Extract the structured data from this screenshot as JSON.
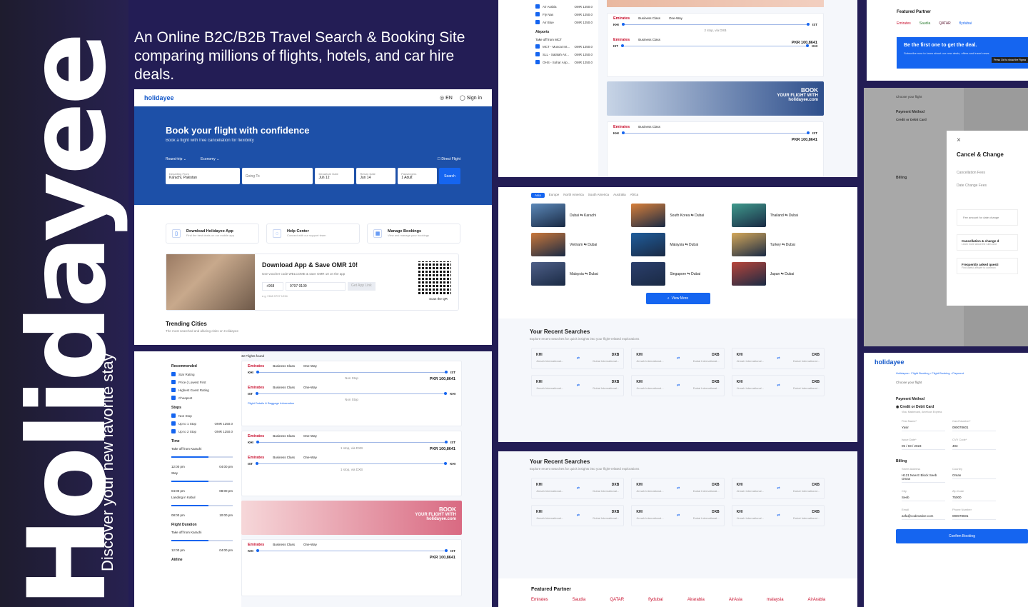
{
  "brand": "Holidayee",
  "tagline": "Discover your new favorite stay",
  "headline": "An Online B2C/B2B Travel Search & Booking Site comparing millions of flights, hotels, and car hire deals.",
  "home": {
    "logo": "holidayee",
    "lang": "EN",
    "signin": "Sign in",
    "hero_title": "Book your flight with confidence",
    "hero_sub": "Book a flight with free cancellation for flexibility",
    "trip_type": "Round-trip",
    "cabin": "Economy",
    "direct": "Direct Flight",
    "from_label": "Departing From",
    "from_value": "Karachi, Pakistan",
    "to_placeholder": "Going To",
    "dep_label": "Departure Date",
    "dep_value": "Jun 12",
    "ret_label": "Return Date",
    "ret_value": "Jun 14",
    "pax_label": "Passengers",
    "pax_value": "1 Adult",
    "search": "Search",
    "cards": [
      {
        "title": "Download Holidayee App",
        "sub": "Find the best deals on our mobile app",
        "icon": "phone-icon"
      },
      {
        "title": "Help Center",
        "sub": "Connect with our support team",
        "icon": "headset-icon"
      },
      {
        "title": "Manage Bookings",
        "sub": "View and manage your bookings",
        "icon": "calendar-icon"
      }
    ],
    "promo_title": "Download App & Save OMR 10!",
    "promo_sub": "Use voucher code WELCOME & save OMR 10 on the app",
    "country_code": "+968",
    "phone": "9797 9109",
    "get_link": "Get App Link",
    "hint": "e.g +968 9797 1234",
    "scan": "Scan the QR",
    "trending_title": "Trending Cities",
    "trending_sub": "The most searched and alluring cities on Holidayee"
  },
  "results": {
    "count": "32 Flights found",
    "filters": {
      "recommended": "Recommended",
      "rec_items": [
        "Star Rating",
        "Price ( Lowest First",
        "Highest Guest Rating",
        "Cheapest"
      ],
      "stops": "Stops",
      "stop_items": [
        {
          "label": "Non Stop",
          "price": ""
        },
        {
          "label": "Up to 1 Stop",
          "price": "OMR 1250.0"
        },
        {
          "label": "Up to 2 Stop",
          "price": "OMR 1250.0"
        }
      ],
      "time": "Time",
      "takeoff": "Take off from Karachi",
      "t1": "12:00 pm",
      "t2": "04:00 pm",
      "stay": "Stay",
      "t3": "04:00 pm",
      "t4": "08:00 pm",
      "landing": "Landing in Kabul",
      "t5": "08:00 pm",
      "t6": "10:00 pm",
      "duration": "Flight Duration",
      "takeoff2": "Take off from Karachi",
      "t7": "12:00 pm",
      "t8": "04:00 pm",
      "airline": "Airline"
    },
    "flights": [
      {
        "airline": "Emirates",
        "class": "Business Class",
        "way": "One-Way",
        "from": "KHI",
        "to": "IST",
        "dtime": "08:00 AM",
        "atime": "10:00 PM",
        "dur": "0h 55m",
        "stops": "Non Stop",
        "price": "PKR 100,8641"
      },
      {
        "airline": "Emirates",
        "class": "Business Class",
        "way": "One-Way",
        "from": "IST",
        "to": "KHI",
        "dtime": "12:00 AM",
        "atime": "02:00 AM",
        "dur": "0h 55m",
        "stops": "Non Stop",
        "price": ""
      },
      {
        "airline": "Emirates",
        "class": "Business Class",
        "way": "One-Way",
        "from": "KHI",
        "to": "IST",
        "dtime": "08:00 AM",
        "atime": "10:00 PM",
        "dur": "0h 55m",
        "stops": "1 stop, via DXB",
        "price": "PKR 100,8641"
      },
      {
        "airline": "Emirates",
        "class": "Business Class",
        "way": "One-Way",
        "from": "IST",
        "to": "KHI",
        "dtime": "12:00 AM",
        "atime": "02:00 AM",
        "dur": "0h 55m",
        "stops": "1 stop, via DXB",
        "price": ""
      }
    ],
    "details": "Flight Details & Baggage Information",
    "banner": "BOOK",
    "banner2": "YOUR FLIGHT WITH",
    "banner3": "holidayee.com"
  },
  "right_top": {
    "airlines": [
      {
        "label": "Air Arabia",
        "price": "OMR 1250.0"
      },
      {
        "label": "Fly Nas",
        "price": "OMR 1250.0"
      },
      {
        "label": "Air Blue",
        "price": "OMR 1250.0"
      }
    ],
    "airports": "Airports",
    "takeoff": "Take off from MCT",
    "airport_items": [
      {
        "label": "MCT - Muscat Int...",
        "price": "OMR 1250.0"
      },
      {
        "label": "SLL - Salalah Air...",
        "price": "OMR 1250.0"
      },
      {
        "label": "OHS - Sohar Airp...",
        "price": "OMR 1250.0"
      }
    ],
    "dur": "10h 55m",
    "stops": "2 stop, via DXB",
    "price": "PKR 100,8641"
  },
  "cities": {
    "tabs": [
      "Asia",
      "Europe",
      "North America",
      "South America",
      "Australia",
      "Africa"
    ],
    "items": [
      {
        "from": "Dubai",
        "to": "Karachi"
      },
      {
        "from": "South Korea",
        "to": "Dubai"
      },
      {
        "from": "Thailand",
        "to": "Dubai"
      },
      {
        "from": "Vietnam",
        "to": "Dubai"
      },
      {
        "from": "Malaysia",
        "to": "Dubai"
      },
      {
        "from": "Turkey",
        "to": "Dubai"
      },
      {
        "from": "Malaysia",
        "to": "Dubai"
      },
      {
        "from": "Singapore",
        "to": "Dubai"
      },
      {
        "from": "Japan",
        "to": "Dubai"
      }
    ],
    "view_more": "View More",
    "recent_title": "Your Recent Searches",
    "recent_sub": "Explore recent searches for quick insights into your flight-related explorations",
    "rs_from": "KHI",
    "rs_to": "DXB",
    "rs_from_name": "Jinnah International...",
    "rs_to_name": "Dubai International..."
  },
  "partners": {
    "title": "Featured Partner",
    "items": [
      "Emirates",
      "Saudia",
      "QATAR",
      "flydubai",
      "Airarabia",
      "AirAsia",
      "malaysia",
      "AirArabia"
    ],
    "deal": "Be the first one to get the deal.",
    "deal_sub": "Subscribe now to know about our new deals, offers and travel news",
    "tooltip": "Press Ctrl to show the Figma"
  },
  "payment": {
    "choose": "Choose your flight",
    "method": "Payment Method",
    "card": "Credit or Debit Card",
    "card_sub": "Visa, Mastercard, American Express",
    "first_name": "First Name*",
    "first_val": "Yasir",
    "card_no": "Card Number*",
    "card_val": "090078601",
    "issue": "Issue Date*",
    "issue_val": "05 / 03 / 2023",
    "cvv": "CVV Code*",
    "cvv_val": "493",
    "billing": "Billing",
    "street": "Street Address",
    "street_val": "H121 New E Block Seeb Oman",
    "country": "Country",
    "country_val": "Oman",
    "city": "City",
    "city_val": "Seeb",
    "zip": "Zip Code",
    "zip_val": "75000",
    "email": "Email",
    "email_val": "asfa@codevative.com",
    "phone": "Phone Number",
    "phone_val": "090078601",
    "confirm": "Confirm Booking",
    "breadcrumb": [
      "Holidayee",
      "Flight Booking",
      "Flight Booking",
      "Payment"
    ]
  },
  "modal": {
    "title": "Cancel & Change",
    "fee1": "Cancellation Fees",
    "fee2": "Date Change Fees",
    "note": "Fee amount for date change",
    "link1": "Cancellation & change d",
    "link1_sub": "Learn more about the rules and",
    "link2": "Frequently asked questi",
    "link2_sub": "Find useful answer to common"
  }
}
